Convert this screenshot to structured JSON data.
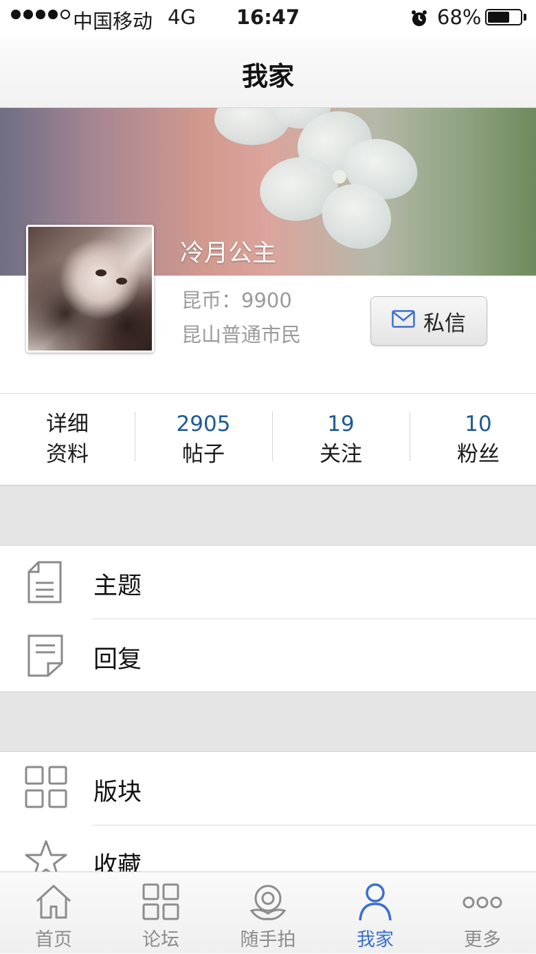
{
  "status_bar": {
    "carrier": "中国移动",
    "network": "4G",
    "time": "16:47",
    "battery_percent": "68%",
    "battery_level": 0.68,
    "signal_bars_filled": 4,
    "signal_bars_total": 5
  },
  "nav": {
    "title": "我家"
  },
  "profile": {
    "username": "冷月公主",
    "coins": "昆币：9900",
    "rank": "昆山普通市民",
    "message_button": "私信"
  },
  "stats": [
    {
      "line1": "详细",
      "line2": "资料"
    },
    {
      "line1": "2905",
      "line2": "帖子"
    },
    {
      "line1": "19",
      "line2": "关注"
    },
    {
      "line1": "10",
      "line2": "粉丝"
    }
  ],
  "menu_group_1": [
    {
      "label": "主题",
      "icon": "document-icon"
    },
    {
      "label": "回复",
      "icon": "reply-note-icon"
    }
  ],
  "menu_group_2": [
    {
      "label": "版块",
      "icon": "grid-icon"
    },
    {
      "label": "收藏",
      "icon": "star-icon"
    }
  ],
  "tabbar": {
    "items": [
      {
        "label": "首页",
        "icon": "home-icon"
      },
      {
        "label": "论坛",
        "icon": "grid-icon"
      },
      {
        "label": "随手拍",
        "icon": "camera-flower-icon"
      },
      {
        "label": "我家",
        "icon": "person-icon"
      },
      {
        "label": "更多",
        "icon": "more-dots-icon"
      }
    ],
    "active_index": 3
  },
  "colors": {
    "accent_blue": "#3a6fcf",
    "stat_number_blue": "#1e5a96",
    "muted_text": "#9b9b9b"
  }
}
